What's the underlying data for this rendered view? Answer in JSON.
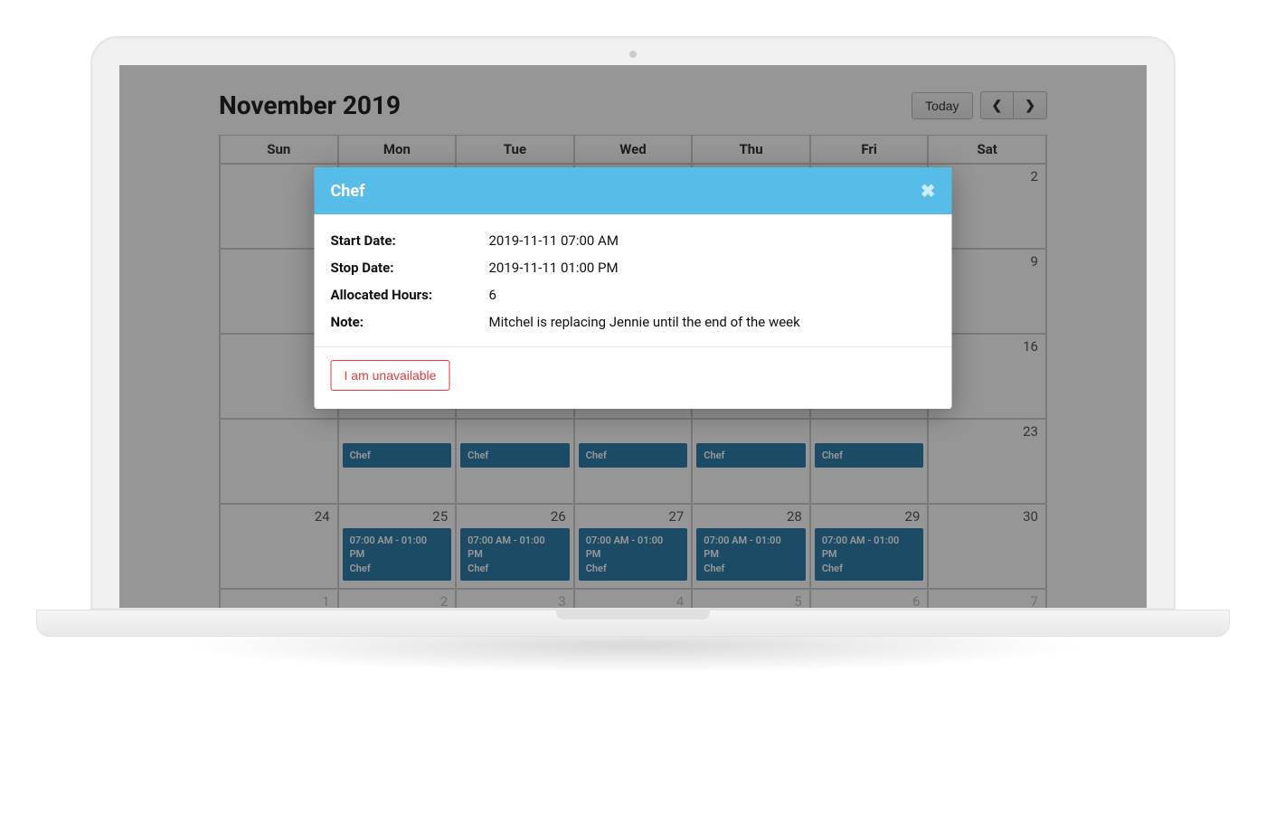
{
  "calendar": {
    "title": "November 2019",
    "today_label": "Today",
    "days_of_week": [
      "Sun",
      "Mon",
      "Tue",
      "Wed",
      "Thu",
      "Fri",
      "Sat"
    ],
    "weeks": [
      [
        {
          "num": "",
          "other": false,
          "event": null
        },
        {
          "num": "",
          "other": false,
          "event": null
        },
        {
          "num": "",
          "other": false,
          "event": null
        },
        {
          "num": "",
          "other": false,
          "event": null
        },
        {
          "num": "",
          "other": false,
          "event": null
        },
        {
          "num": "",
          "other": false,
          "event": null
        },
        {
          "num": "2",
          "other": false,
          "event": null
        }
      ],
      [
        {
          "num": "",
          "other": false,
          "event": null
        },
        {
          "num": "",
          "other": false,
          "event": null
        },
        {
          "num": "",
          "other": false,
          "event": null
        },
        {
          "num": "",
          "other": false,
          "event": null
        },
        {
          "num": "",
          "other": false,
          "event": null
        },
        {
          "num": "",
          "other": false,
          "event": null
        },
        {
          "num": "9",
          "other": false,
          "event": null
        }
      ],
      [
        {
          "num": "",
          "other": false,
          "event": null
        },
        {
          "num": "",
          "other": false,
          "event": null
        },
        {
          "num": "",
          "other": false,
          "event": null
        },
        {
          "num": "",
          "other": false,
          "event": null
        },
        {
          "num": "",
          "other": false,
          "event": null
        },
        {
          "num": "",
          "other": false,
          "event": null
        },
        {
          "num": "16",
          "other": false,
          "event": null
        }
      ],
      [
        {
          "num": "",
          "other": false,
          "event": null
        },
        {
          "num": "",
          "other": false,
          "event": {
            "time": "",
            "role": "Chef"
          }
        },
        {
          "num": "",
          "other": false,
          "event": {
            "time": "",
            "role": "Chef"
          }
        },
        {
          "num": "",
          "other": false,
          "event": {
            "time": "",
            "role": "Chef"
          }
        },
        {
          "num": "",
          "other": false,
          "event": {
            "time": "",
            "role": "Chef"
          }
        },
        {
          "num": "",
          "other": false,
          "event": {
            "time": "",
            "role": "Chef"
          }
        },
        {
          "num": "23",
          "other": false,
          "event": null
        }
      ],
      [
        {
          "num": "24",
          "other": false,
          "event": null
        },
        {
          "num": "25",
          "other": false,
          "event": {
            "time": "07:00 AM - 01:00 PM",
            "role": "Chef"
          }
        },
        {
          "num": "26",
          "other": false,
          "event": {
            "time": "07:00 AM - 01:00 PM",
            "role": "Chef"
          }
        },
        {
          "num": "27",
          "other": false,
          "event": {
            "time": "07:00 AM - 01:00 PM",
            "role": "Chef"
          }
        },
        {
          "num": "28",
          "other": false,
          "event": {
            "time": "07:00 AM - 01:00 PM",
            "role": "Chef"
          }
        },
        {
          "num": "29",
          "other": false,
          "event": {
            "time": "07:00 AM - 01:00 PM",
            "role": "Chef"
          }
        },
        {
          "num": "30",
          "other": false,
          "event": null
        }
      ]
    ],
    "trailing_week": [
      {
        "num": "1"
      },
      {
        "num": "2"
      },
      {
        "num": "3"
      },
      {
        "num": "4"
      },
      {
        "num": "5"
      },
      {
        "num": "6"
      },
      {
        "num": "7"
      }
    ]
  },
  "modal": {
    "title": "Chef",
    "labels": {
      "start": "Start Date:",
      "stop": "Stop Date:",
      "hours": "Allocated Hours:",
      "note": "Note:"
    },
    "values": {
      "start": "2019-11-11 07:00 AM",
      "stop": "2019-11-11 01:00 PM",
      "hours": "6",
      "note": "Mitchel is replacing Jennie until the end of the week"
    },
    "unavailable_label": "I am unavailable"
  }
}
